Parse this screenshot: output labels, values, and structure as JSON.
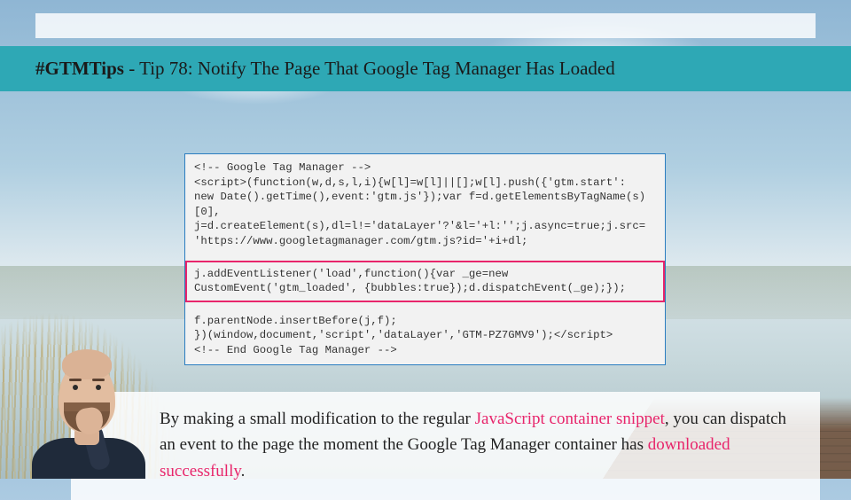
{
  "title": {
    "hashtag": "#GTMTips",
    "rest": " - Tip 78: Notify The Page That Google Tag Manager Has Loaded"
  },
  "code": {
    "pre": "<!-- Google Tag Manager -->\n<script>(function(w,d,s,l,i){w[l]=w[l]||[];w[l].push({'gtm.start':\nnew Date().getTime(),event:'gtm.js'});var f=d.getElementsByTagName(s)[0],\nj=d.createElement(s),dl=l!='dataLayer'?'&l='+l:'';j.async=true;j.src=\n'https://www.googletagmanager.com/gtm.js?id='+i+dl;",
    "highlight": "j.addEventListener('load',function(){var _ge=new CustomEvent('gtm_loaded',\n{bubbles:true});d.dispatchEvent(_ge);});",
    "post": "f.parentNode.insertBefore(j,f);\n})(window,document,'script','dataLayer','GTM-PZ7GMV9');</script>\n<!-- End Google Tag Manager -->"
  },
  "body": {
    "part1": "By making a small modification to the regular ",
    "pink1": "JavaScript container snippet",
    "part2": ", you can dispatch an event to the page the moment the Google Tag Manager container has ",
    "pink2": "downloaded successfully",
    "part3": "."
  },
  "colors": {
    "titlebar": "#2ea8b5",
    "highlight_border": "#e8256b",
    "code_border": "#2b7dc0"
  }
}
